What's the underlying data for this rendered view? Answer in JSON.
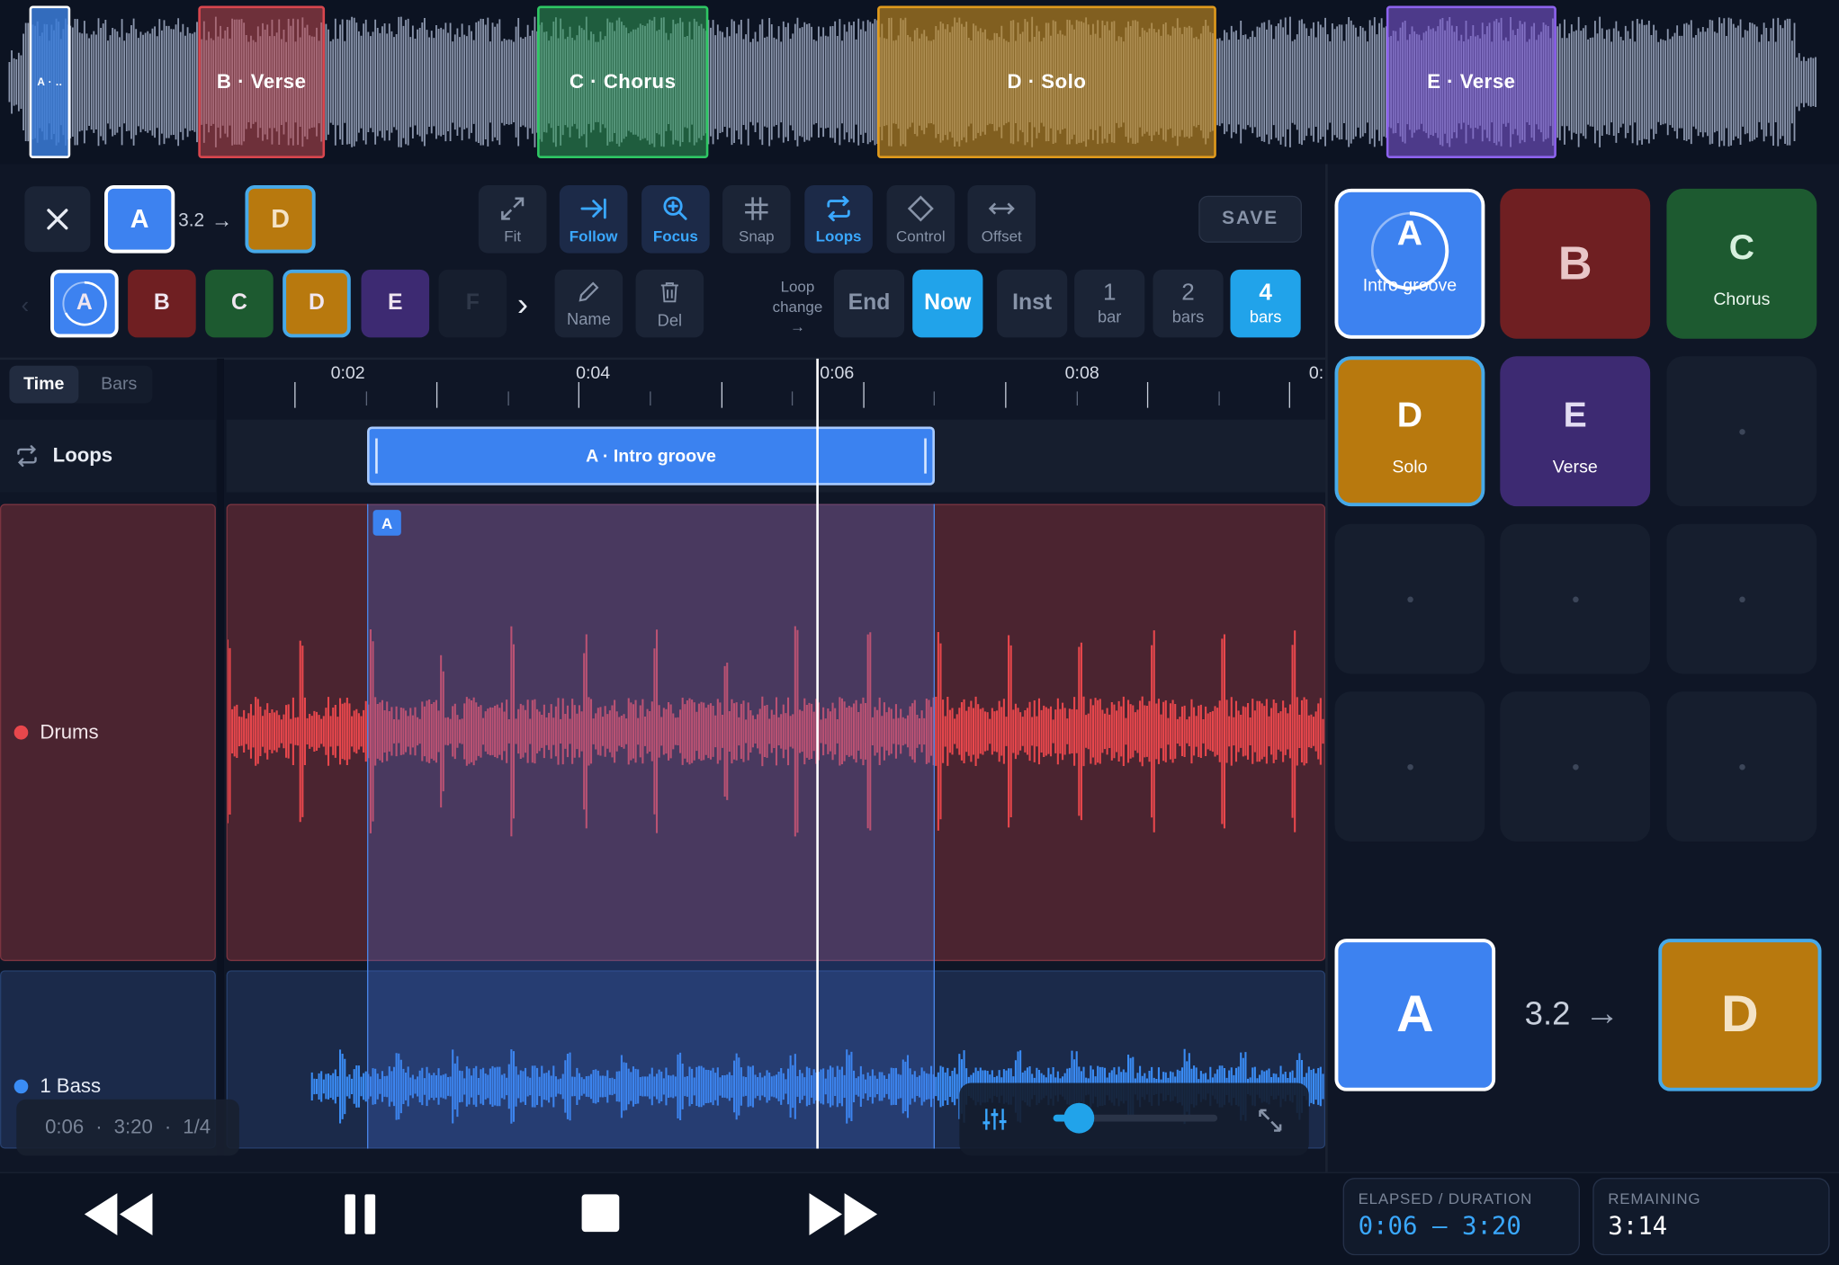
{
  "overview": {
    "sections": [
      {
        "label": "A · Intro groove",
        "short": "A · ..",
        "color": "#3b7dd8"
      },
      {
        "label": "B · Verse",
        "color": "#c0484f"
      },
      {
        "label": "C · Chorus",
        "color": "#2f9a55"
      },
      {
        "label": "D · Solo",
        "color": "#c08820"
      },
      {
        "label": "E · Verse",
        "color": "#7a55d0"
      }
    ]
  },
  "toolbar": {
    "current_section": "A",
    "transition_bars": "3.2",
    "next_section": "D",
    "tools": [
      {
        "label": "Fit",
        "icon": "fit-icon",
        "active": false
      },
      {
        "label": "Follow",
        "icon": "follow-icon",
        "active": true
      },
      {
        "label": "Focus",
        "icon": "focus-icon",
        "active": true
      },
      {
        "label": "Snap",
        "icon": "snap-icon",
        "active": false
      },
      {
        "label": "Loops",
        "icon": "loops-icon",
        "active": true
      },
      {
        "label": "Control",
        "icon": "control-icon",
        "active": false
      },
      {
        "label": "Offset",
        "icon": "offset-icon",
        "active": false
      }
    ],
    "save_label": "SAVE",
    "section_chips": [
      "A",
      "B",
      "C",
      "D",
      "E",
      "F"
    ],
    "name_label": "Name",
    "del_label": "Del",
    "loop_change_label": [
      "Loop",
      "change"
    ],
    "quantize": [
      {
        "top": "End",
        "bottom": "",
        "active": false
      },
      {
        "top": "Now",
        "bottom": "",
        "active": true
      },
      {
        "top": "Inst",
        "bottom": "",
        "active": false
      },
      {
        "top": "1",
        "bottom": "bar",
        "active": false
      },
      {
        "top": "2",
        "bottom": "bars",
        "active": false
      },
      {
        "top": "4",
        "bottom": "bars",
        "active": true
      }
    ]
  },
  "timeline": {
    "tabs": [
      "Time",
      "Bars"
    ],
    "active_tab": "Time",
    "ruler_labels": [
      "0:02",
      "0:04",
      "0:06",
      "0:08",
      "0:"
    ],
    "loops_label": "Loops",
    "loop_region_label": "A · Intro groove",
    "loop_marker": "A",
    "tracks": [
      {
        "name": "Drums",
        "color": "#e8474c"
      },
      {
        "name": "1 Bass",
        "color": "#3a8cf5"
      }
    ],
    "status": {
      "elapsed": "0:06",
      "duration": "3:20",
      "fraction": "1/4"
    },
    "volume_level": 0.16
  },
  "pads": [
    {
      "letter": "A",
      "name": "Intro groove",
      "color": "#3d82f0"
    },
    {
      "letter": "B",
      "name": "",
      "color": "#6f1f22"
    },
    {
      "letter": "C",
      "name": "Chorus",
      "color": "#1d5a30"
    },
    {
      "letter": "D",
      "name": "Solo",
      "color": "#b8790e"
    },
    {
      "letter": "E",
      "name": "Verse",
      "color": "#3d2a72"
    }
  ],
  "transition": {
    "from": "A",
    "bars": "3.2",
    "to": "D"
  },
  "readouts": {
    "elapsed_label": "ELAPSED / DURATION",
    "elapsed_value": "0:06 – 3:20",
    "remaining_label": "REMAINING",
    "remaining_value": "3:14"
  },
  "transport": {
    "buttons": [
      "rewind-icon",
      "pause-icon",
      "stop-icon",
      "fast-forward-icon"
    ]
  }
}
